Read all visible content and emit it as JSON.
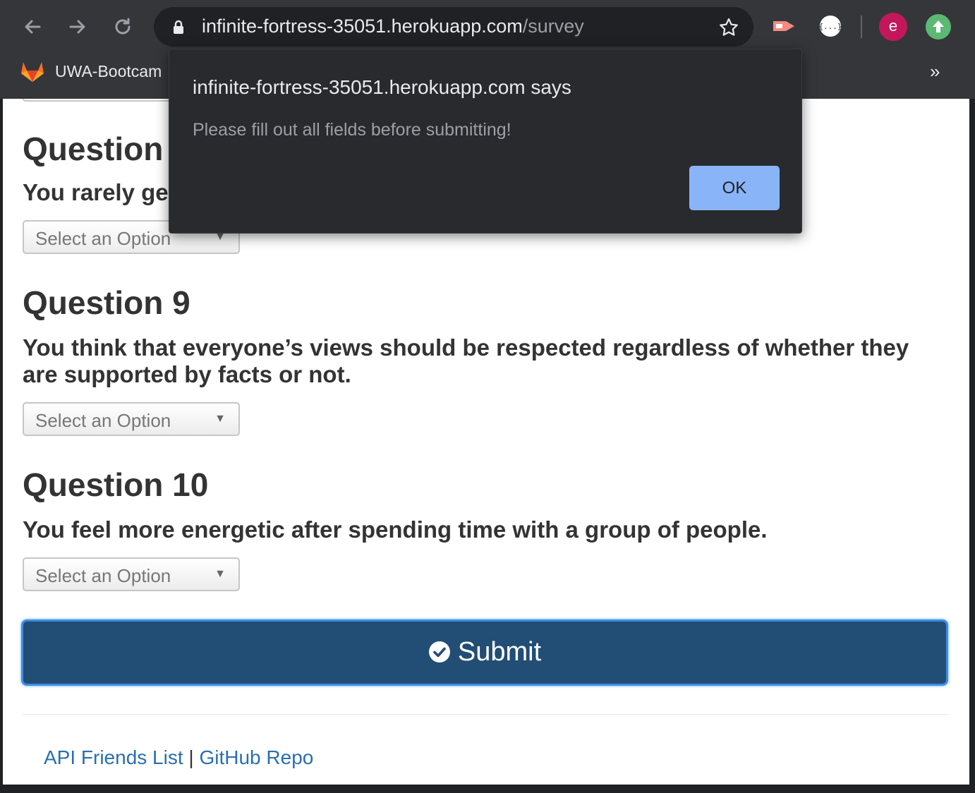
{
  "browser": {
    "url_host": "infinite-fortress-35051.herokuapp.com",
    "url_path": "/survey",
    "bookmark_label": "UWA-Bootcam",
    "more_bookmarks": "»",
    "avatar_letter": "e",
    "accent_color": "#8ab4f8"
  },
  "page": {
    "question8": {
      "title": "Question",
      "text_fragment": "You rarely ge",
      "select_value": "Select an Option"
    },
    "question9": {
      "title": "Question 9",
      "text": "You think that everyone’s views should be respected regardless of whether they are supported by facts or not.",
      "select_value": "Select an Option"
    },
    "question10": {
      "title": "Question 10",
      "text": "You feel more energetic after spending time with a group of people.",
      "select_value": "Select an Option"
    },
    "submit_label": "Submit",
    "submit_color": "#224d75",
    "footer": {
      "link1": "API Friends List",
      "separator": "|",
      "link2": "GitHub Repo"
    }
  },
  "dialog": {
    "title": "infinite-fortress-35051.herokuapp.com says",
    "message": "Please fill out all fields before submitting!",
    "ok_label": "OK"
  },
  "icons": [
    "back-icon",
    "forward-icon",
    "reload-icon",
    "lock-icon",
    "star-icon",
    "extension-icon",
    "json-icon",
    "update-icon",
    "gitlab-icon",
    "check-circle-icon",
    "dropdown-arrow-icon"
  ]
}
